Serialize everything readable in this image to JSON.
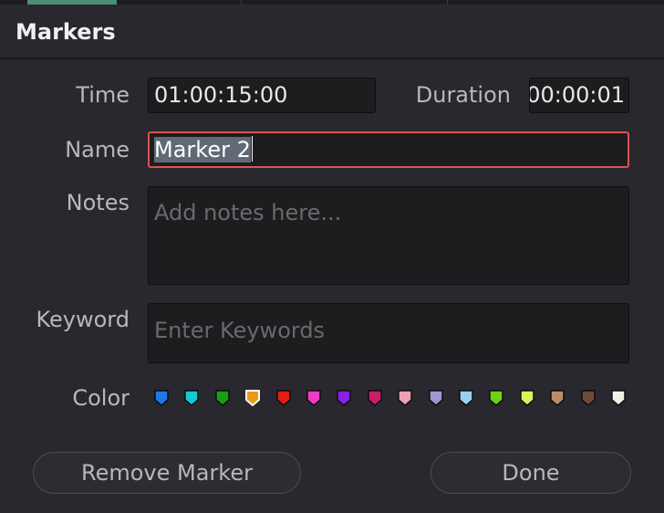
{
  "dialog": {
    "title": "Markers"
  },
  "fields": {
    "time": {
      "label": "Time",
      "value": "01:00:15:00"
    },
    "duration": {
      "label": "Duration",
      "value": "00:00:01"
    },
    "name": {
      "label": "Name",
      "value": "Marker 2"
    },
    "notes": {
      "label": "Notes",
      "placeholder": "Add notes here..."
    },
    "keyword": {
      "label": "Keyword",
      "placeholder": "Enter Keywords"
    }
  },
  "color": {
    "label": "Color",
    "selected_index": 3,
    "swatches": [
      {
        "name": "blue",
        "hex": "#1e78e6"
      },
      {
        "name": "cyan",
        "hex": "#14c8d2"
      },
      {
        "name": "green",
        "hex": "#14a014"
      },
      {
        "name": "yellow",
        "hex": "#eb9b14"
      },
      {
        "name": "red",
        "hex": "#e11e14"
      },
      {
        "name": "pink",
        "hex": "#eb3cc8"
      },
      {
        "name": "purple",
        "hex": "#8c1ee6"
      },
      {
        "name": "fuchsia",
        "hex": "#c81e6e"
      },
      {
        "name": "rose",
        "hex": "#f0a0b4"
      },
      {
        "name": "lavender",
        "hex": "#a096d2"
      },
      {
        "name": "sky",
        "hex": "#96d2f0"
      },
      {
        "name": "mint",
        "hex": "#6ed214"
      },
      {
        "name": "lemon",
        "hex": "#dcf05a"
      },
      {
        "name": "sand",
        "hex": "#be8c64"
      },
      {
        "name": "cocoa",
        "hex": "#6e4b3c"
      },
      {
        "name": "cream",
        "hex": "#f5f0e6"
      }
    ]
  },
  "buttons": {
    "remove": "Remove Marker",
    "done": "Done"
  },
  "colors": {
    "background": "#28282e",
    "field": "#1d1d1f",
    "focus_border": "#d9534f",
    "selection": "#5f6a75"
  }
}
